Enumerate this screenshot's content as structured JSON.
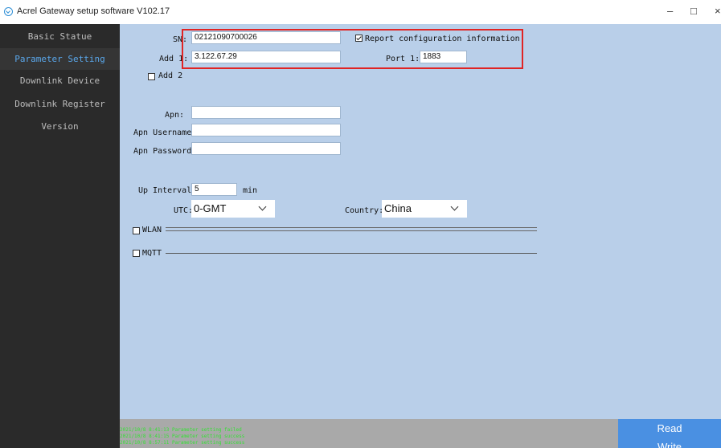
{
  "window": {
    "title": "Acrel Gateway setup software V102.17",
    "minimize": "–",
    "maximize": "□",
    "close": "×"
  },
  "sidebar": {
    "items": [
      {
        "label": "Basic Statue",
        "active": false
      },
      {
        "label": "Parameter Setting",
        "active": true
      },
      {
        "label": "Downlink Device",
        "active": false
      },
      {
        "label": "Downlink Register",
        "active": false
      },
      {
        "label": "Version",
        "active": false
      }
    ]
  },
  "form": {
    "sn_label": "SN:",
    "sn_value": "02121090700026",
    "report_config_label": "Report configuration information",
    "report_config_checked": true,
    "add1_label": "Add 1:",
    "add1_value": "3.122.67.29",
    "port1_label": "Port 1:",
    "port1_value": "1883",
    "add2_label": "Add 2",
    "add2_checked": false,
    "apn_label": "Apn:",
    "apn_value": "",
    "apn_username_label": "Apn Username:",
    "apn_username_value": "",
    "apn_password_label": "Apn Password:",
    "apn_password_value": "",
    "up_interval_label": "Up Interval:",
    "up_interval_value": "5",
    "up_interval_unit": "min",
    "utc_label": "UTC:",
    "utc_value": "0-GMT",
    "country_label": "Country:",
    "country_value": "China",
    "wlan_label": "WLAN",
    "wlan_checked": false,
    "mqtt_label": "MQTT",
    "mqtt_checked": false
  },
  "log": {
    "lines": [
      "2021/10/8 8:41:13  Parameter setting failed",
      "2021/10/8 8:41:15  Parameter setting success",
      "2021/10/8 8:57:11  Parameter setting success"
    ]
  },
  "actions": {
    "read_label": "Read",
    "write_label": "Write"
  },
  "colors": {
    "sidebar_bg": "#2a2a2a",
    "main_bg": "#b9cfe9",
    "active_text": "#5aa7ea",
    "highlight_border": "#e02424",
    "button_panel": "#4a90e2",
    "log_text": "#35e035"
  }
}
